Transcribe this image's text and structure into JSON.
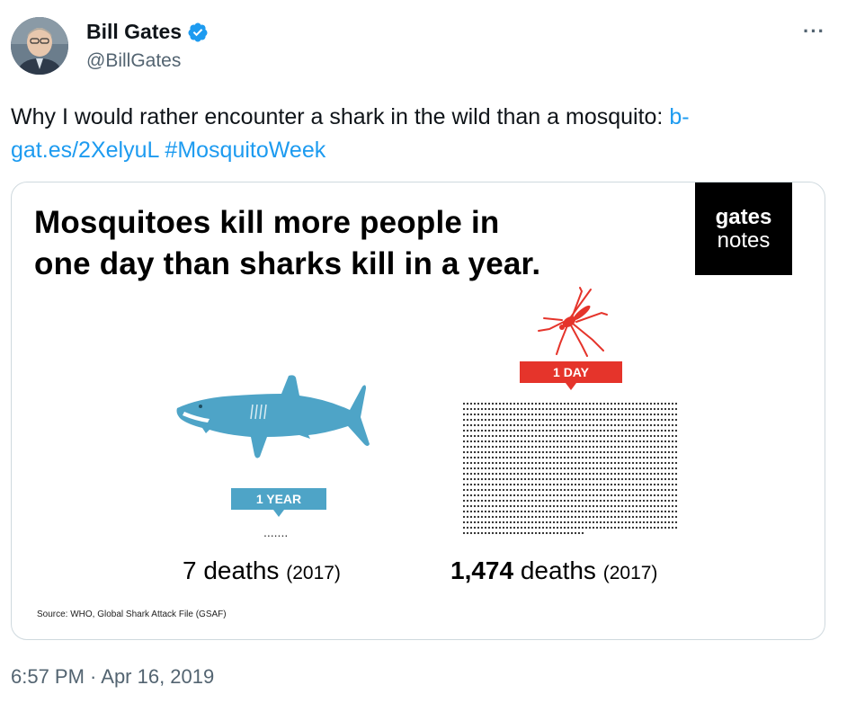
{
  "author": {
    "display_name": "Bill Gates",
    "handle": "@BillGates",
    "verified": true
  },
  "more_button": "···",
  "tweet": {
    "text": "Why I would rather encounter a shark in the wild than a mosquito: ",
    "link": "b-gat.es/2XelyuL",
    "link_line1": "b-",
    "link_line2": "gat.es/2XelyuL",
    "hashtag": "#MosquitoWeek"
  },
  "card": {
    "headline_line1": "Mosquitoes kill more people in",
    "headline_line2": "one day than sharks kill in a year.",
    "logo_line1": "gates",
    "logo_line2": "notes",
    "shark": {
      "badge": "1 YEAR",
      "dots": ".......",
      "deaths_number": "7",
      "deaths_word": " deaths ",
      "year": "(2017)"
    },
    "mosquito": {
      "badge": "1 DAY",
      "deaths_number": "1,474",
      "deaths_word": " deaths ",
      "year": "(2017)",
      "dot_count": 1474
    },
    "source": "Source: WHO, Global Shark Attack File (GSAF)"
  },
  "timestamp": "6:57 PM · Apr 16, 2019",
  "colors": {
    "link": "#1d9bf0",
    "shark": "#4ea4c7",
    "mosquito": "#e5342b",
    "verified": "#1d9bf0"
  },
  "icons": {
    "verified": "verified-badge-icon",
    "more": "more-dots-icon",
    "shark": "shark-illustration",
    "mosquito": "mosquito-illustration"
  }
}
